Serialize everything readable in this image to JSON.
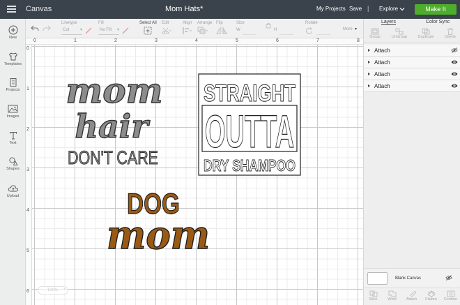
{
  "header": {
    "app_name": "Canvas",
    "project_title": "Mom Hats*",
    "my_projects": "My Projects",
    "save": "Save",
    "separator": "|",
    "explore": "Explore",
    "make_it": "Make It"
  },
  "toolbar": {
    "linetype_label": "Linetype",
    "linetype_value": "Cut",
    "fill_label": "Fill",
    "fill_value": "No Fill",
    "select_all": "Select All",
    "edit": "Edit",
    "align": "Align",
    "arrange": "Arrange",
    "flip": "Flip",
    "size": "Size",
    "size_w": "W",
    "size_h": "H",
    "rotate": "Rotate",
    "more": "More"
  },
  "sidebar": {
    "items": [
      {
        "label": "New",
        "icon": "plus-circle-icon"
      },
      {
        "label": "Templates",
        "icon": "tshirt-icon"
      },
      {
        "label": "Projects",
        "icon": "projects-icon"
      },
      {
        "label": "Images",
        "icon": "image-icon"
      },
      {
        "label": "Text",
        "icon": "text-icon"
      },
      {
        "label": "Shapes",
        "icon": "shapes-icon"
      },
      {
        "label": "Upload",
        "icon": "upload-cloud-icon"
      }
    ]
  },
  "ruler": {
    "top": [
      "0",
      "1",
      "2",
      "3",
      "4",
      "5",
      "6",
      "7",
      "8"
    ],
    "left": [
      "0",
      "1",
      "2",
      "3",
      "4",
      "5",
      "6"
    ]
  },
  "zoom": {
    "minus": "−",
    "value": "100%",
    "plus": "+"
  },
  "designs": {
    "mom_hair": {
      "line1": "mom",
      "line2": "hair",
      "line3": "DON'T CARE"
    },
    "straight_outta": {
      "line1": "STRAIGHT",
      "line2": "OUTTA",
      "line3": "DRY SHAMPOO"
    },
    "dog_mom": {
      "line1": "DOG",
      "line2": "mom"
    }
  },
  "right_panel": {
    "tabs": [
      "Layers",
      "Color Sync"
    ],
    "top_tools": [
      "Group",
      "UnGroup",
      "Duplicate",
      "Delete"
    ],
    "layers": [
      {
        "name": "Attach",
        "visible": false
      },
      {
        "name": "Attach",
        "visible": true
      },
      {
        "name": "Attach",
        "visible": true
      },
      {
        "name": "Attach",
        "visible": true
      }
    ],
    "blank_canvas": "Blank Canvas",
    "bottom_tools": [
      "Slice",
      "Weld",
      "Attach",
      "Flatten",
      "Contour"
    ]
  },
  "colors": {
    "topbar": "#3a424b",
    "make_it": "#4ead2c",
    "mom_hair_fill": "#8c8c8c",
    "dog_mom_fill": "#9a5a14"
  }
}
